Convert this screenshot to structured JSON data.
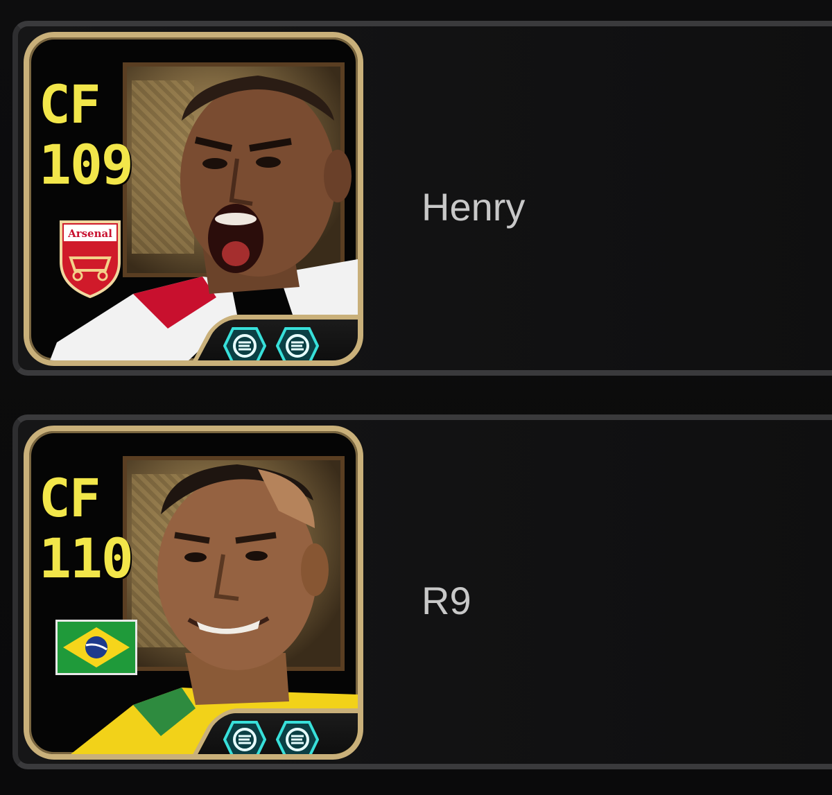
{
  "players": [
    {
      "position": "CF",
      "rating": "109",
      "name": "Henry",
      "badge": "club-crest",
      "badge_text": "Arsenal",
      "skills": [
        "skill-e-icon",
        "skill-e-icon"
      ]
    },
    {
      "position": "CF",
      "rating": "110",
      "name": "R9",
      "badge": "country-flag",
      "skills": [
        "skill-e-icon",
        "skill-e-icon"
      ]
    }
  ],
  "colors": {
    "card_border": "#c9b07a",
    "rating_text": "#f2e64a",
    "name_text": "#c8c8c8",
    "skill_glow": "#34d6d0",
    "background": "#0b0b0c"
  }
}
